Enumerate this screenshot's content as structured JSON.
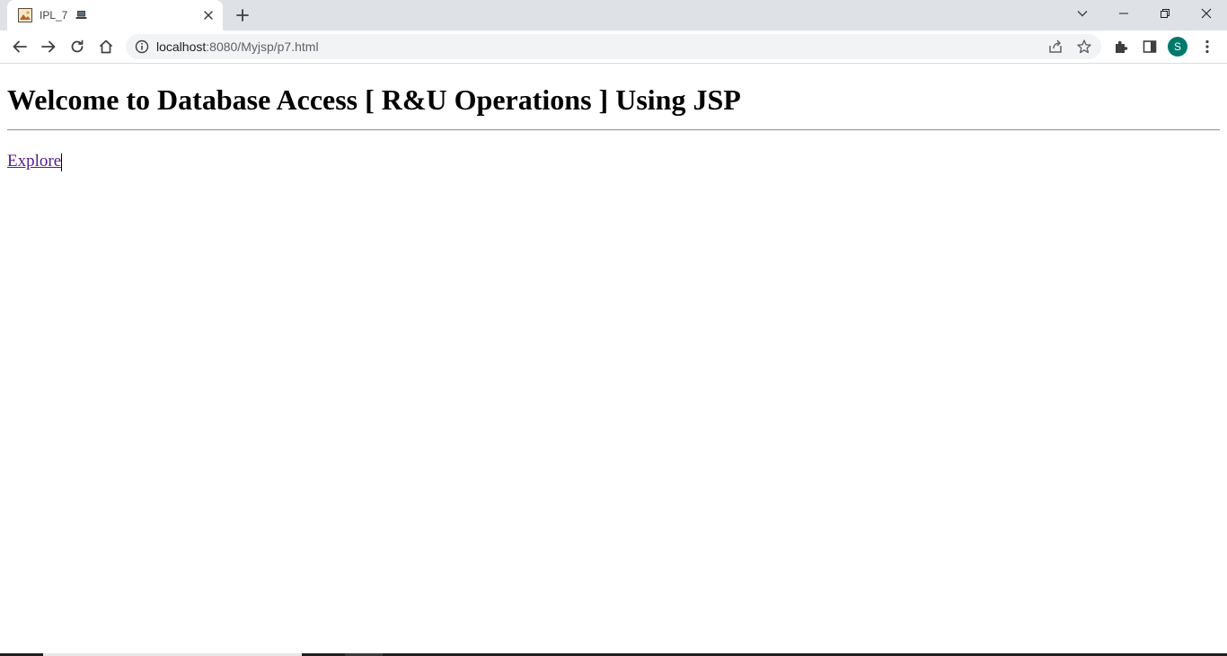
{
  "browser": {
    "tab": {
      "title": "IPL_7",
      "favicon": "image-favicon",
      "title_emoji_icon": "laptop-icon"
    },
    "window_controls": [
      "tab-search",
      "minimize",
      "restore",
      "close"
    ],
    "address_bar": {
      "host": "localhost",
      "path": ":8080/Myjsp/p7.html"
    },
    "profile_initial": "S",
    "colors": {
      "tabstrip_bg": "#dee1e6",
      "omnibox_bg": "#f1f3f4",
      "avatar": "#00796b",
      "visited_link": "#551a8b"
    }
  },
  "page": {
    "heading": "Welcome to Database Access [ R&U Operations ] Using JSP",
    "link_label": "Explore"
  }
}
